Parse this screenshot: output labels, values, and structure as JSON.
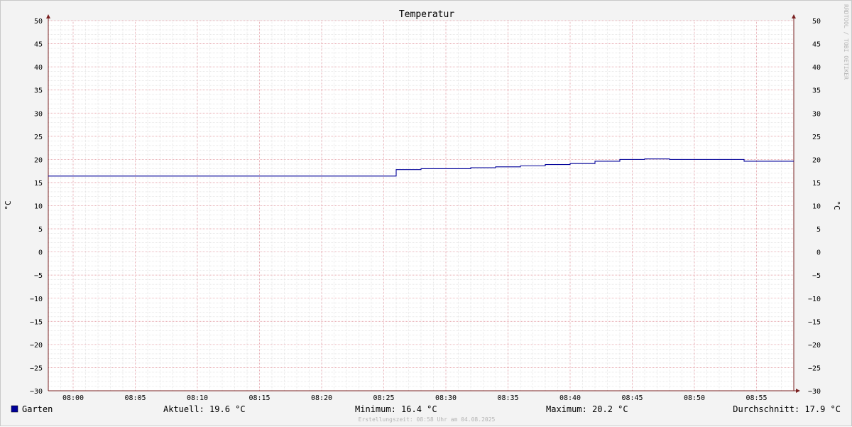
{
  "chart_data": {
    "type": "line",
    "title": "Temperatur",
    "ylabel": "°C",
    "ylim": [
      -30,
      50
    ],
    "yticks": [
      50,
      45,
      40,
      35,
      30,
      25,
      20,
      15,
      10,
      5,
      0,
      -5,
      -10,
      -15,
      -20,
      -25,
      -30
    ],
    "xlim": [
      "07:58",
      "08:58"
    ],
    "xticks": [
      "08:00",
      "08:05",
      "08:10",
      "08:15",
      "08:20",
      "08:25",
      "08:30",
      "08:35",
      "08:40",
      "08:45",
      "08:50",
      "08:55"
    ],
    "grid": true,
    "step": true,
    "series": [
      {
        "name": "Garten",
        "color": "#000099",
        "x": [
          "07:58",
          "08:26",
          "08:28",
          "08:32",
          "08:34",
          "08:36",
          "08:38",
          "08:40",
          "08:42",
          "08:44",
          "08:46",
          "08:48",
          "08:50",
          "08:52",
          "08:54",
          "08:56",
          "08:58"
        ],
        "y": [
          16.4,
          17.8,
          18.0,
          18.2,
          18.4,
          18.6,
          18.9,
          19.1,
          19.6,
          20.0,
          20.1,
          20.0,
          20.0,
          20.0,
          19.6,
          19.6,
          19.6
        ]
      }
    ]
  },
  "legend": {
    "swatch_color": "#000099",
    "series_label": "Garten",
    "current": "Aktuell: 19.6 °C",
    "minimum": "Minimum: 16.4 °C",
    "maximum": "Maximum: 20.2 °C",
    "average": "Durchschnitt: 17.9 °C"
  },
  "footer": "Erstellungszeit: 08:58 Uhr am 04.08.2025",
  "watermark": "RRDTOOL / TOBI OETIKER",
  "colors": {
    "background": "#f3f3f3",
    "plot": "#ffffff",
    "grid_minor": "#dcdcdc",
    "grid_major": "#e6a0a8",
    "axis": "#7a2020"
  }
}
